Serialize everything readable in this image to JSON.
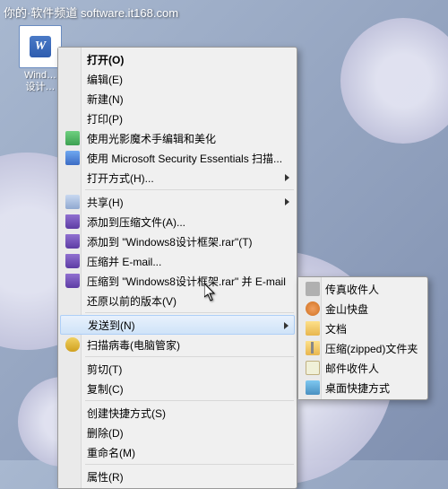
{
  "watermark": "你的·软件频道 software.it168.com",
  "desktop": {
    "file_label_line1": "Wind…",
    "file_label_line2": "设计…"
  },
  "main_menu": {
    "items": [
      "打开(O)",
      "编辑(E)",
      "新建(N)",
      "打印(P)",
      "使用光影魔术手编辑和美化",
      "使用 Microsoft Security Essentials 扫描...",
      "打开方式(H)...",
      "共享(H)",
      "添加到压缩文件(A)...",
      "添加到 \"Windows8设计框架.rar\"(T)",
      "压缩并 E-mail...",
      "压缩到 \"Windows8设计框架.rar\" 并 E-mail",
      "还原以前的版本(V)",
      "发送到(N)",
      "扫描病毒(电脑管家)",
      "剪切(T)",
      "复制(C)",
      "创建快捷方式(S)",
      "删除(D)",
      "重命名(M)",
      "属性(R)"
    ]
  },
  "sub_menu": {
    "items": [
      "传真收件人",
      "金山快盘",
      "文档",
      "压缩(zipped)文件夹",
      "邮件收件人",
      "桌面快捷方式"
    ]
  }
}
